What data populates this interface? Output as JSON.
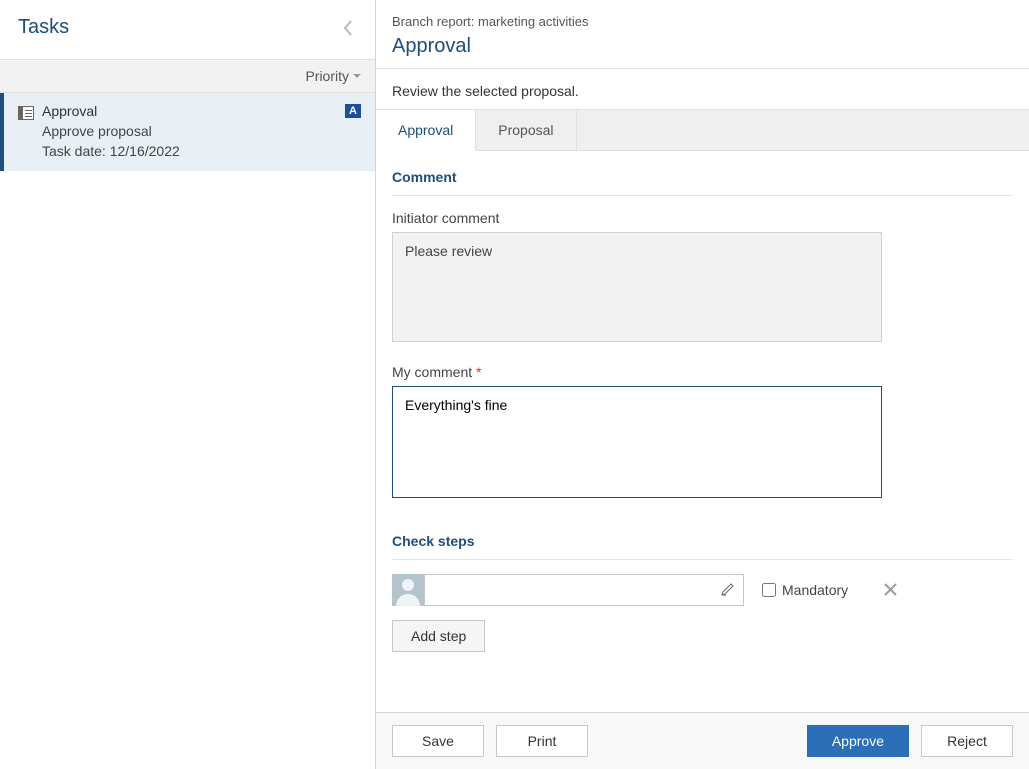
{
  "sidebar": {
    "title": "Tasks",
    "sort_label": "Priority",
    "task": {
      "title": "Approval",
      "badge": "A",
      "subtitle": "Approve proposal",
      "date_label": "Task date: 12/16/2022"
    }
  },
  "header": {
    "breadcrumb": "Branch report: marketing activities",
    "title": "Approval"
  },
  "instruction": "Review the selected proposal.",
  "tabs": {
    "approval": "Approval",
    "proposal": "Proposal"
  },
  "comment": {
    "section_title": "Comment",
    "initiator_label": "Initiator comment",
    "initiator_value": "Please review",
    "my_label": "My comment",
    "my_value": "Everything's fine"
  },
  "checksteps": {
    "section_title": "Check steps",
    "mandatory_label": "Mandatory",
    "add_step_label": "Add step"
  },
  "footer": {
    "save": "Save",
    "print": "Print",
    "approve": "Approve",
    "reject": "Reject"
  }
}
